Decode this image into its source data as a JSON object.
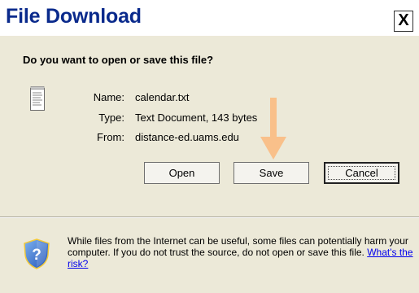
{
  "window": {
    "title": "File Download",
    "close_glyph": "X"
  },
  "prompt": {
    "question": "Do you want to open or save this file?"
  },
  "file_info": {
    "icon": "text-file-icon",
    "name_label": "Name:",
    "name_value": "calendar.txt",
    "type_label": "Type:",
    "type_value": "Text Document, 143 bytes",
    "from_label": "From:",
    "from_value": "distance-ed.uams.edu"
  },
  "buttons": {
    "open_label": "Open",
    "save_label": "Save",
    "cancel_label": "Cancel"
  },
  "annotation": {
    "arrow_color": "#f9c08a",
    "icon": "down-arrow-icon"
  },
  "warning": {
    "icon": "shield-question-icon",
    "text": "While files from the Internet can be useful, some files can potentially harm your computer. If you do not trust the source, do not open or save this file.",
    "link_text": "What's the risk?"
  },
  "colors": {
    "title_color": "#0a2a8c",
    "dialog_background": "#ece9d8",
    "link_color": "#0000ee"
  }
}
